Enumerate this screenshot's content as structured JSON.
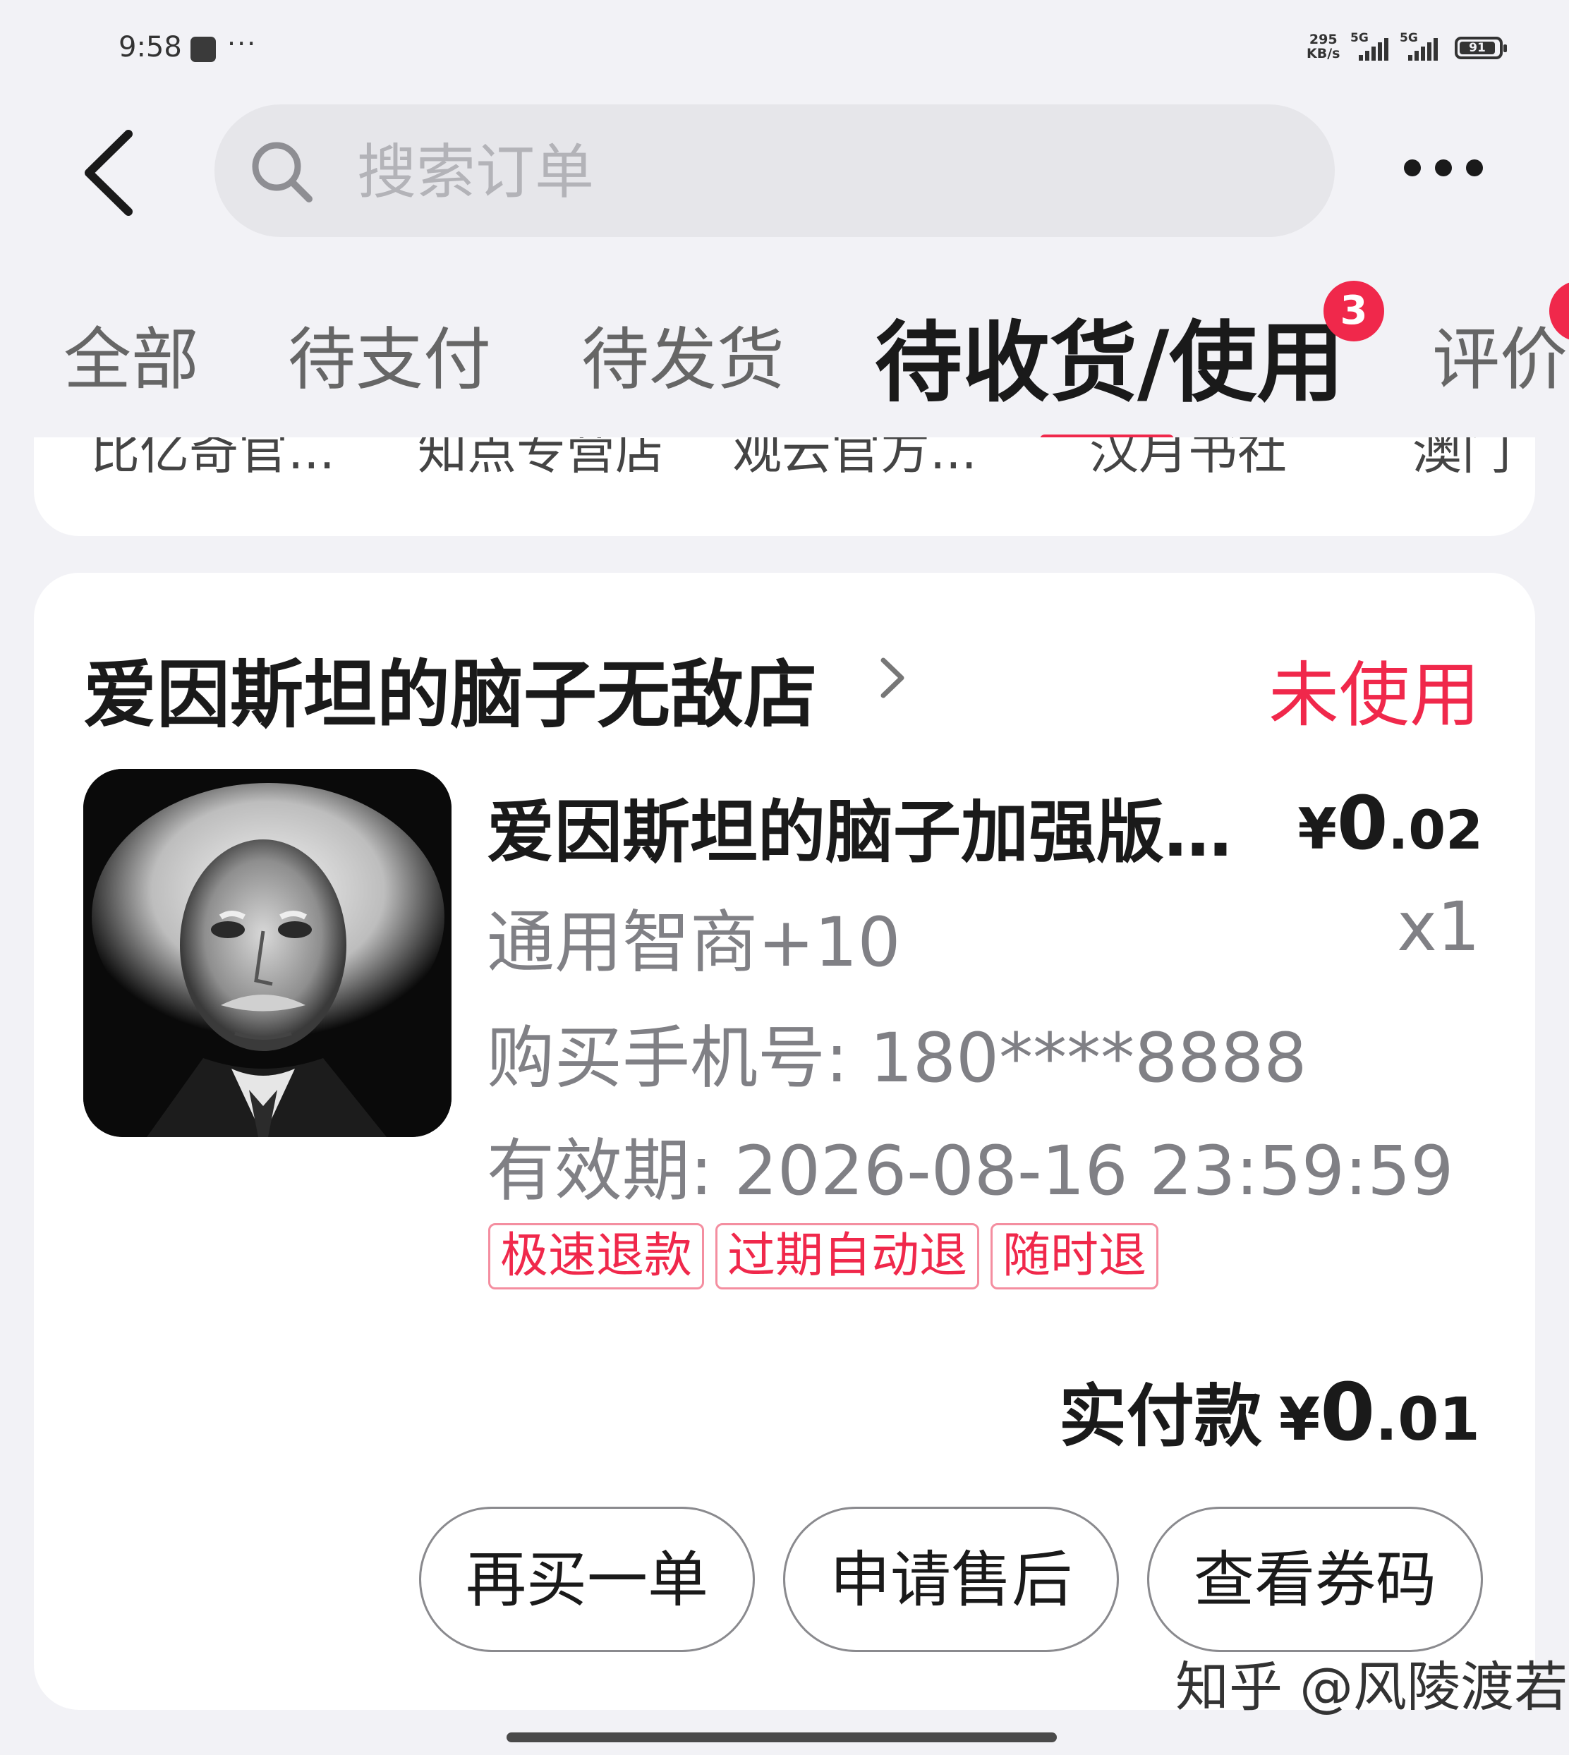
{
  "status_bar": {
    "time": "9:58",
    "more": "···",
    "net_speed_value": "295",
    "net_speed_unit": "KB/s",
    "signal_1_label": "5G",
    "signal_2_label": "5G",
    "battery": "91"
  },
  "header": {
    "search_placeholder": "搜索订单"
  },
  "tabs": [
    {
      "label": "全部"
    },
    {
      "label": "待支付"
    },
    {
      "label": "待发货"
    },
    {
      "label": "待收货/使用",
      "active": true,
      "badge": "3"
    },
    {
      "label": "评价"
    }
  ],
  "store_strip": [
    "比亿奇官...",
    "知点专营店",
    "观云官方...",
    "汉月书社",
    "澳门"
  ],
  "order": {
    "shop_name": "爱因斯坦的脑子无敌店",
    "status": "未使用",
    "product_title": "爱因斯坦的脑子加强版，...",
    "price_symbol": "¥",
    "price_int": "0",
    "price_dec": ".02",
    "spec": "通用智商+10",
    "quantity": "x1",
    "phone": "购买手机号: 180****8888",
    "validity": "有效期: 2026-08-16 23:59:59",
    "tags": [
      "极速退款",
      "过期自动退",
      "随时退"
    ],
    "paid_label": "实付款",
    "paid_symbol": "¥",
    "paid_int": "0",
    "paid_dec": ".01",
    "buttons": {
      "rebuy": "再买一单",
      "after_sale": "申请售后",
      "view_code": "查看券码"
    }
  },
  "watermark": "知乎 @风陵渡若水",
  "colors": {
    "accent": "#f0284b",
    "background": "#f2f2f6",
    "card": "#ffffff"
  }
}
